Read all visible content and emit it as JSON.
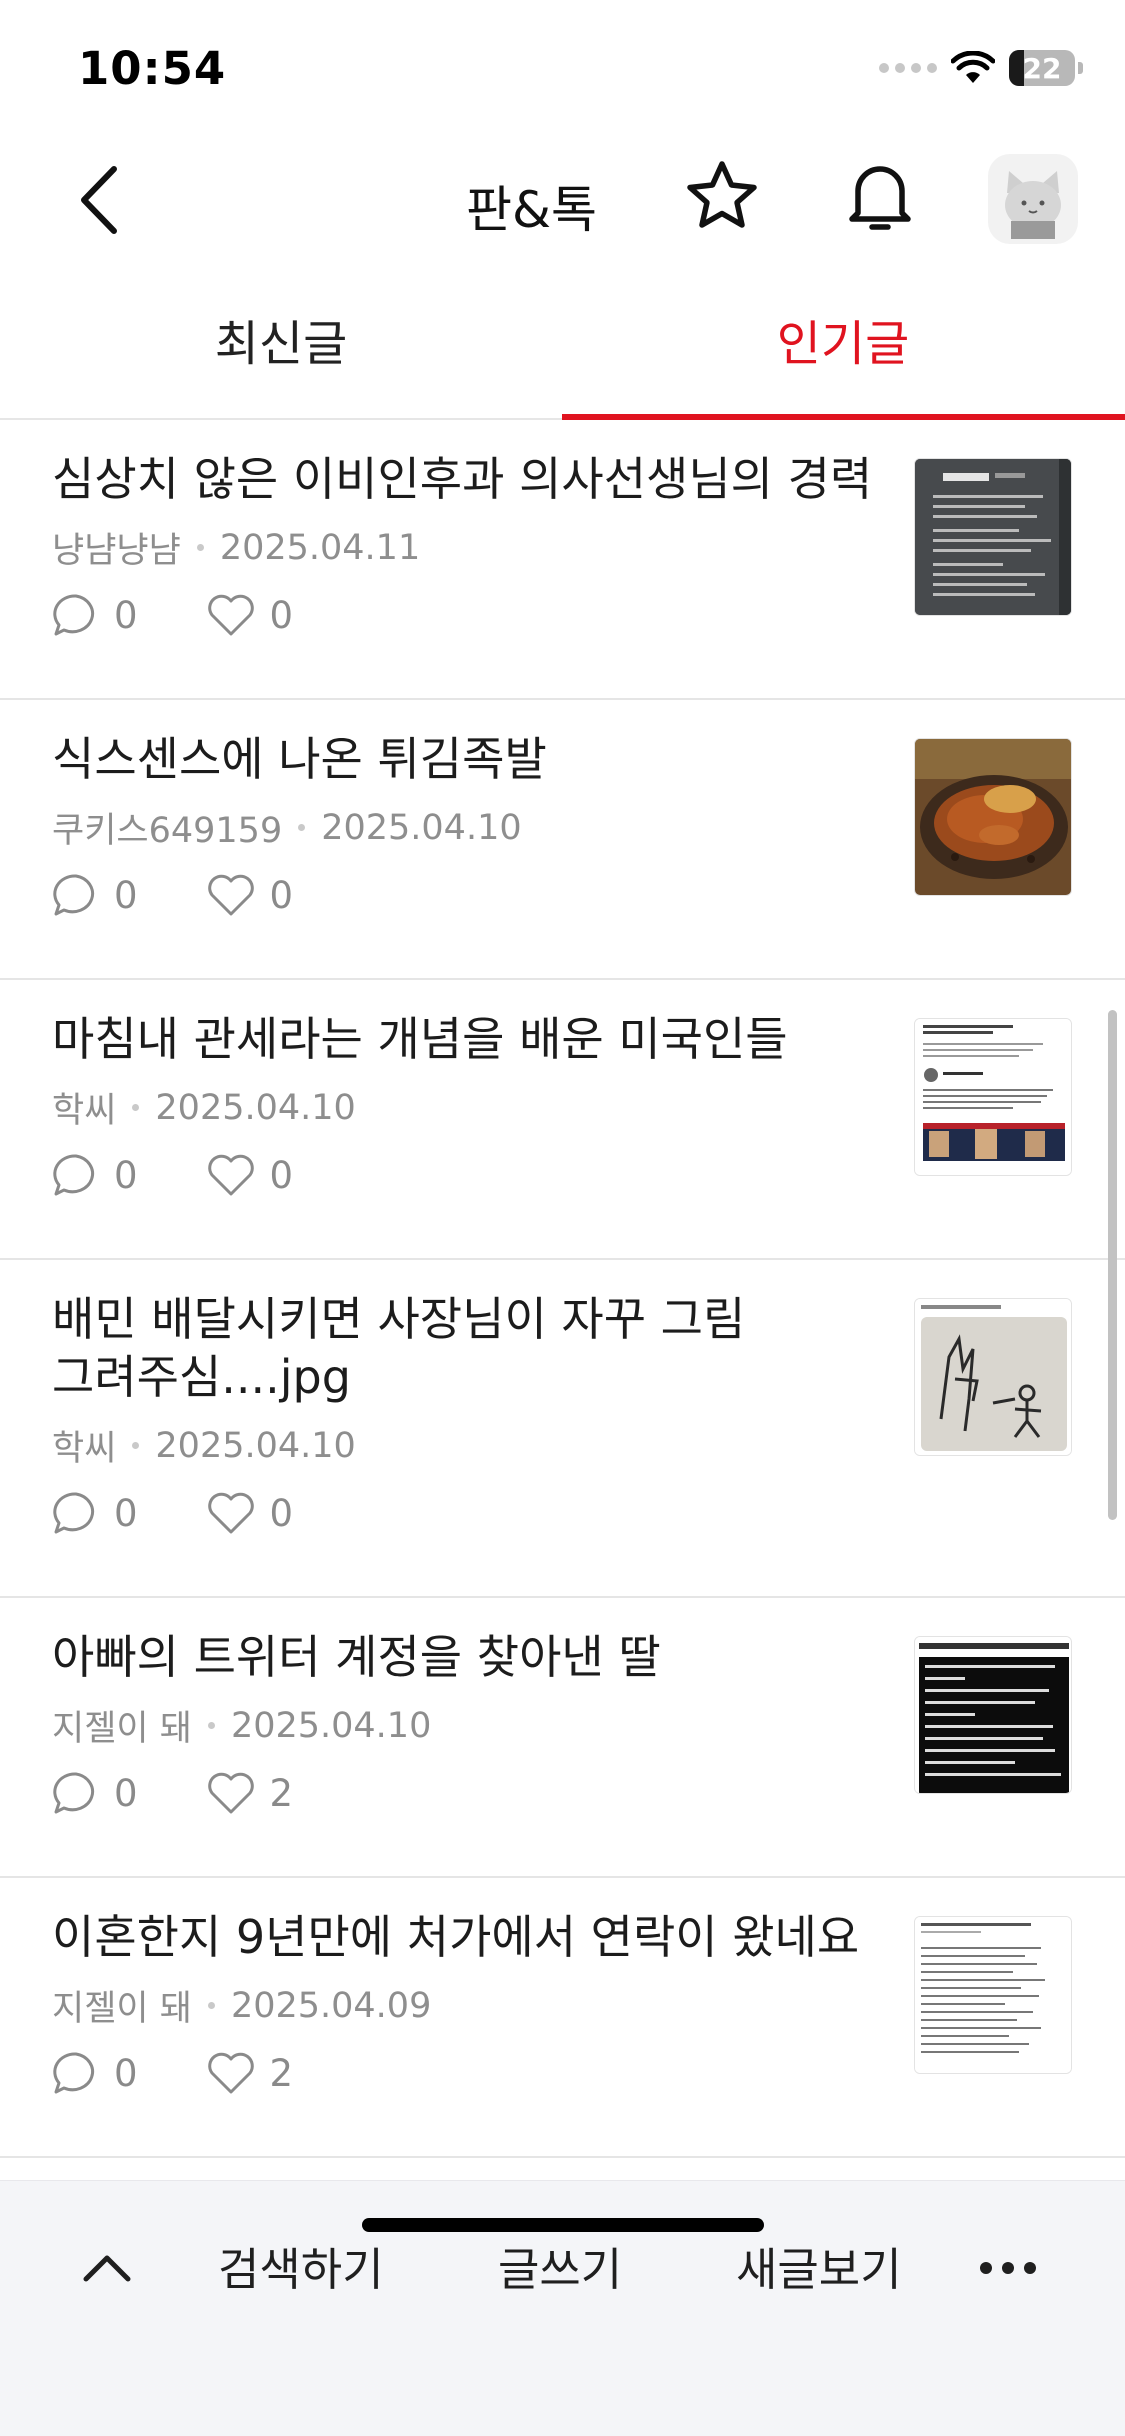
{
  "status_bar": {
    "time": "10:54",
    "battery": "22"
  },
  "header": {
    "title": "판&톡"
  },
  "tabs": [
    {
      "label": "최신글",
      "active": false
    },
    {
      "label": "인기글",
      "active": true
    }
  ],
  "posts": [
    {
      "title": "심상치 않은 이비인후과 의사선생님의 경력",
      "author": "냥냠냥냠",
      "date": "2025.04.11",
      "comments": "0",
      "likes": "0",
      "thumb": "text-screenshot"
    },
    {
      "title": "식스센스에 나온 튀김족발",
      "author": "쿠키스649159",
      "date": "2025.04.10",
      "comments": "0",
      "likes": "0",
      "thumb": "food-photo"
    },
    {
      "title": "마침내 관세라는 개념을 배운 미국인들",
      "author": "학씨",
      "date": "2025.04.10",
      "comments": "0",
      "likes": "0",
      "thumb": "tweet-screenshot"
    },
    {
      "title": "배민 배달시키면 사장님이 자꾸 그림 그려주심....jpg",
      "author": "학씨",
      "date": "2025.04.10",
      "comments": "0",
      "likes": "0",
      "thumb": "drawing-photo"
    },
    {
      "title": "아빠의 트위터 계정을 찾아낸 딸",
      "author": "지젤이 돼",
      "date": "2025.04.10",
      "comments": "0",
      "likes": "2",
      "thumb": "dark-text-screenshot"
    },
    {
      "title": "이혼한지 9년만에 처가에서 연락이 왔네요",
      "author": "지젤이 돼",
      "date": "2025.04.09",
      "comments": "0",
      "likes": "2",
      "thumb": "text-screenshot"
    }
  ],
  "bottom_bar": {
    "search": "검색하기",
    "write": "글쓰기",
    "new_posts": "새글보기"
  },
  "colors": {
    "accent": "#e0131f",
    "meta_text": "#8e8e8e",
    "bottom_bg": "#f4f5f8"
  }
}
